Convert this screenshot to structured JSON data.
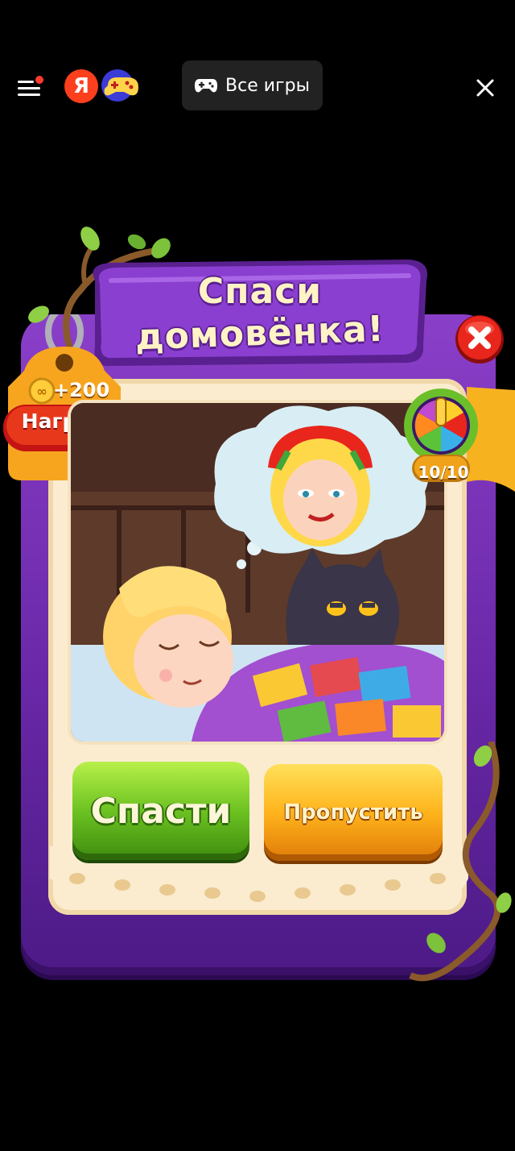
{
  "topbar": {
    "logo_letter": "Я",
    "all_games_label": "Все игры"
  },
  "dialog": {
    "title_line1": "Спаси",
    "title_line2": "домовёнка!",
    "reward_amount": "+200",
    "reward_label": "Награда",
    "level_progress": "10/10",
    "save_button": "Спасти",
    "skip_button": "Пропустить"
  },
  "colors": {
    "frame_purple": "#7a34b8",
    "save_green": "#6cc221",
    "skip_orange": "#ffb41c",
    "close_red": "#e8261c",
    "yandex_red": "#fc3f1d"
  }
}
